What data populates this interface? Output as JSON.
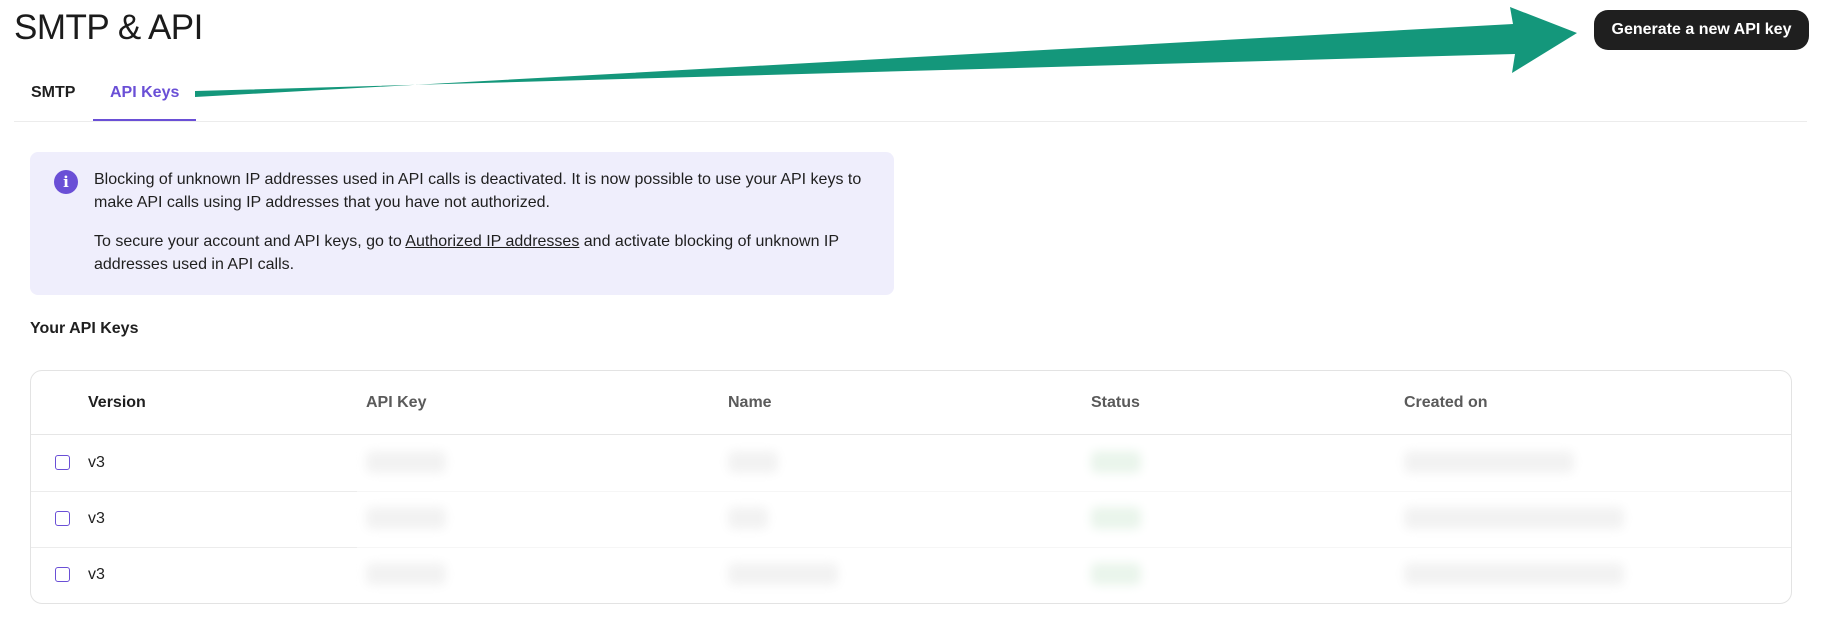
{
  "page": {
    "title": "SMTP & API",
    "generate_button_label": "Generate a new API key"
  },
  "tabs": [
    {
      "label": "SMTP",
      "active": false
    },
    {
      "label": "API Keys",
      "active": true
    }
  ],
  "banner": {
    "icon": "info-icon",
    "icon_glyph": "i",
    "paragraph1": "Blocking of unknown IP addresses used in API calls is deactivated. It is now possible to use your API keys to make API calls using IP addresses that you have not authorized.",
    "paragraph2_before": "To secure your account and API keys, go to ",
    "paragraph2_link": "Authorized IP addresses",
    "paragraph2_after": " and activate blocking of unknown IP addresses used in API calls."
  },
  "api_keys": {
    "section_title": "Your API Keys",
    "columns": [
      "Version",
      "API Key",
      "Name",
      "Status",
      "Created on"
    ],
    "rows": [
      {
        "version": "v3"
      },
      {
        "version": "v3"
      },
      {
        "version": "v3"
      }
    ]
  },
  "colors": {
    "accent": "#6a4fd6",
    "banner_bg": "#efeefc",
    "button_bg": "#1f1f1f",
    "annotation_arrow": "#14977b"
  }
}
